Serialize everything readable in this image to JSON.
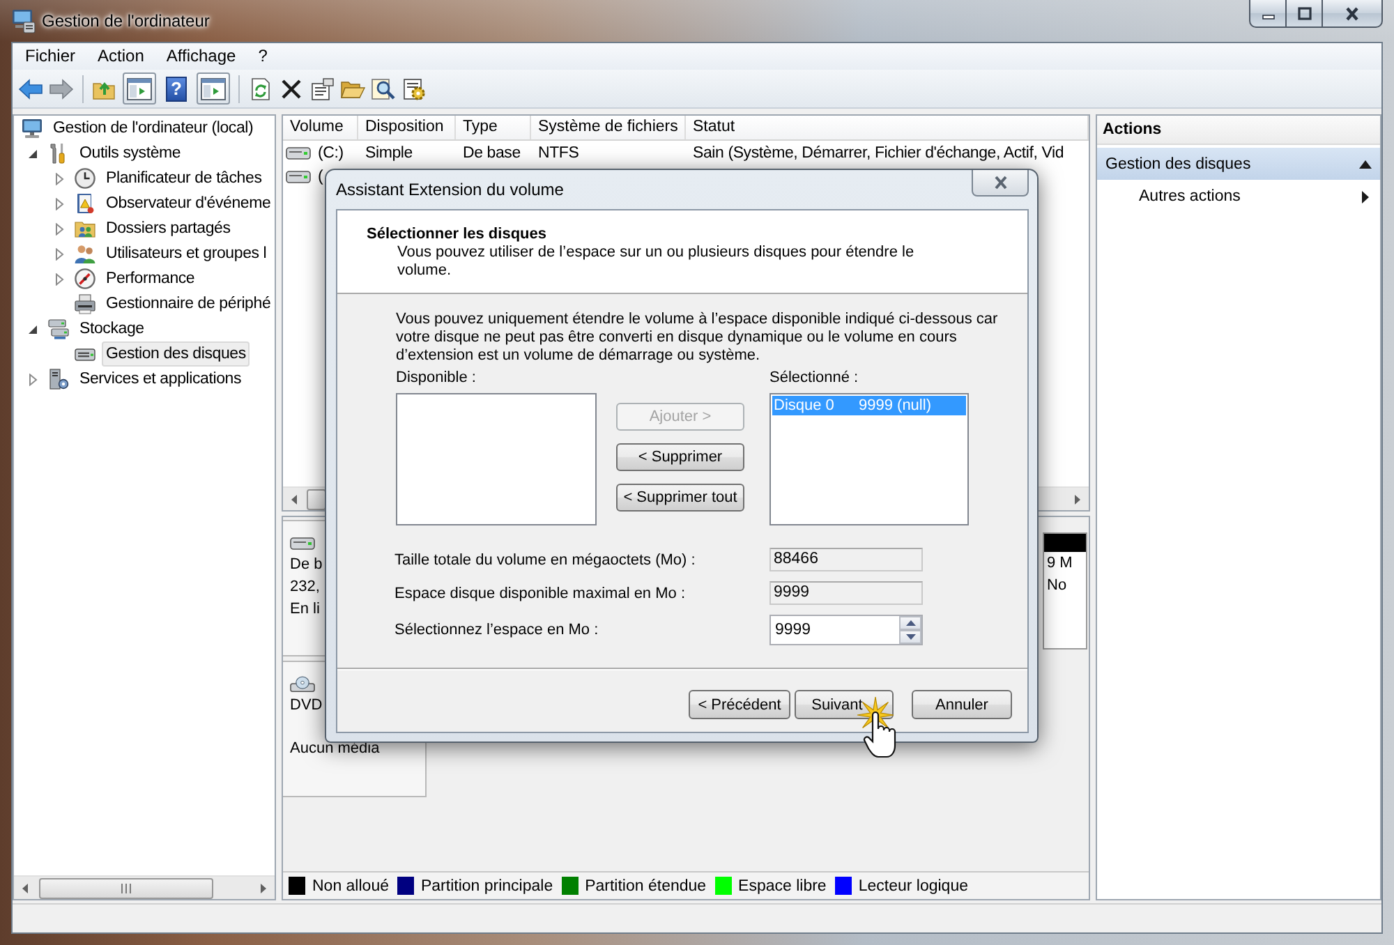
{
  "window": {
    "title": "Gestion de l'ordinateur"
  },
  "menu": [
    {
      "label": "Fichier"
    },
    {
      "label": "Action"
    },
    {
      "label": "Affichage"
    },
    {
      "label": "?"
    }
  ],
  "toolbar": {
    "back": {
      "disabled": false
    },
    "forward": {
      "disabled": true
    },
    "console_tree_toggle": {
      "on": true
    },
    "help": {
      "glyph": "?"
    },
    "action_pane_toggle": {
      "on": true
    }
  },
  "tree": [
    {
      "label": "Gestion de l'ordinateur (local)",
      "kind": "computer",
      "expandable": false,
      "selected": false,
      "children": [
        {
          "label": "Outils système",
          "kind": "tools",
          "expandable": true,
          "expanded": true,
          "selected": false,
          "children": [
            {
              "label": "Planificateur de tâches",
              "kind": "scheduler",
              "expandable": true,
              "expanded": false,
              "selected": false
            },
            {
              "label": "Observateur d'événeme",
              "kind": "event-viewer",
              "expandable": true,
              "expanded": false,
              "selected": false
            },
            {
              "label": "Dossiers partagés",
              "kind": "shared-folders",
              "expandable": true,
              "expanded": false,
              "selected": false
            },
            {
              "label": "Utilisateurs et groupes l",
              "kind": "users",
              "expandable": true,
              "expanded": false,
              "selected": false
            },
            {
              "label": "Performance",
              "kind": "performance",
              "expandable": true,
              "expanded": false,
              "selected": false
            },
            {
              "label": "Gestionnaire de périphé",
              "kind": "device-manager",
              "expandable": false,
              "selected": false
            }
          ]
        },
        {
          "label": "Stockage",
          "kind": "storage",
          "expandable": true,
          "expanded": true,
          "selected": false,
          "children": [
            {
              "label": "Gestion des disques",
              "kind": "disk-management",
              "expandable": false,
              "selected": true
            }
          ]
        },
        {
          "label": "Services et applications",
          "kind": "services",
          "expandable": true,
          "expanded": false,
          "selected": false
        }
      ]
    }
  ],
  "volumes": {
    "columns": [
      "Volume",
      "Disposition",
      "Type",
      "Système de fichiers",
      "Statut"
    ],
    "rows": [
      {
        "cells": [
          "(C:)",
          "Simple",
          "De base",
          "NTFS",
          "Sain (Système, Démarrer, Fichier d'échange, Actif, Vid"
        ]
      },
      {
        "cells": [
          "("
        ]
      }
    ]
  },
  "disks": [
    {
      "kind": "hdd",
      "info": [
        "De b",
        "232,",
        "En li"
      ],
      "partition": {
        "color": "#000000",
        "lines": [
          "9 M",
          "No"
        ]
      }
    },
    {
      "kind": "dvd",
      "info": [
        "DVD"
      ],
      "media": "Aucun média"
    }
  ],
  "legend": [
    {
      "label": "Non alloué",
      "color": "#000000"
    },
    {
      "label": "Partition principale",
      "color": "#000080"
    },
    {
      "label": "Partition étendue",
      "color": "#008000"
    },
    {
      "label": "Espace libre",
      "color": "#00ff00"
    },
    {
      "label": "Lecteur logique",
      "color": "#0000ff"
    }
  ],
  "actions": {
    "title": "Actions",
    "section": {
      "label": "Gestion des disques",
      "expanded": true
    },
    "items": [
      {
        "label": "Autres actions",
        "submenu": true
      }
    ]
  },
  "dialog": {
    "title": "Assistant Extension du volume",
    "heading": "Sélectionner les disques",
    "subtitle": "Vous pouvez utiliser de l’espace sur un ou plusieurs disques pour étendre le\nvolume.",
    "note": "Vous pouvez uniquement étendre le volume à l’espace disponible indiqué ci-dessous car\nvotre disque ne peut pas être converti en disque dynamique ou le volume en cours\nd’extension est un volume de démarrage ou système.",
    "available": {
      "label": "Disponible :"
    },
    "selected_list": {
      "label": "Sélectionné :",
      "items": [
        {
          "disk": "Disque 0",
          "size": "9999 (null)",
          "selected": true
        }
      ]
    },
    "move_buttons": [
      {
        "label": "Ajouter >",
        "disabled": true
      },
      {
        "label": "< Supprimer",
        "disabled": false
      },
      {
        "label": "< Supprimer tout",
        "disabled": false
      }
    ],
    "fields": [
      {
        "kind": "readonly",
        "label": "Taille totale du volume en mégaoctets (Mo) :",
        "value": "88466"
      },
      {
        "kind": "readonly",
        "label": "Espace disque disponible maximal en Mo :",
        "value": "9999"
      },
      {
        "kind": "spin",
        "label": "Sélectionnez l’espace en Mo :",
        "value": "9999"
      }
    ],
    "buttons": [
      {
        "label": "< Précédent"
      },
      {
        "label": "Suivant"
      },
      {
        "label": "Annuler"
      }
    ]
  }
}
